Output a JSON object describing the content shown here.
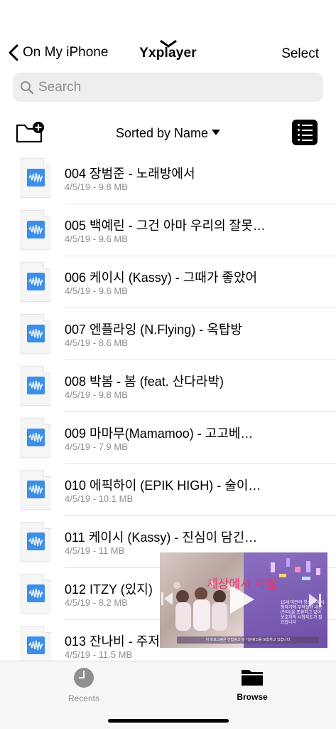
{
  "nav": {
    "back_label": "On My iPhone",
    "title": "Yxplayer",
    "select_label": "Select"
  },
  "search": {
    "placeholder": "Search"
  },
  "toolbar": {
    "sort_label": "Sorted by Name"
  },
  "files": [
    {
      "name": "004 장범준 - 노래방에서",
      "meta": "4/5/19 - 9.8 MB"
    },
    {
      "name": "005 백예린 - 그건 아마 우리의 잘못…",
      "meta": "4/5/19 - 9.6 MB"
    },
    {
      "name": "006 케이시 (Kassy) - 그때가 좋았어",
      "meta": "4/5/19 - 9.6 MB"
    },
    {
      "name": "007 엔플라잉 (N.Flying) - 옥탑방",
      "meta": "4/5/19 - 8.6 MB"
    },
    {
      "name": "008 박봄 - 봄 (feat. 산다라박)",
      "meta": "4/5/19 - 9.8 MB"
    },
    {
      "name": "009 마마무(Mamamoo) - 고고베…",
      "meta": "4/5/19 - 7.9 MB"
    },
    {
      "name": "010 에픽하이 (EPIK HIGH) - 술이…",
      "meta": "4/5/19 - 10.1 MB"
    },
    {
      "name": "011 케이시 (Kassy) - 진심이 담긴…",
      "meta": "4/5/19 - 11 MB"
    },
    {
      "name": "012 ITZY (있지)",
      "meta": "4/5/19 - 8.2 MB"
    },
    {
      "name": "013 잔나비 - 주저",
      "meta": "4/5/19 - 11.5 MB"
    }
  ],
  "video": {
    "caption": "세상에서 제일...",
    "side_text": "15세 미만의 청소년이 시청하기에 부적절한 내용(언어)을 포함하고 있어 보호자의 시청지도가 필요합니다",
    "bottom_bar": "이 프로그램은 간접광고 및 가상광고를 포함하고 있습니다"
  },
  "tabbar": {
    "recents_label": "Recents",
    "browse_label": "Browse"
  },
  "colors": {
    "accent": "#3b8fe8",
    "video_purple": "#7a5db4",
    "caption_pink": "#e8346f"
  }
}
